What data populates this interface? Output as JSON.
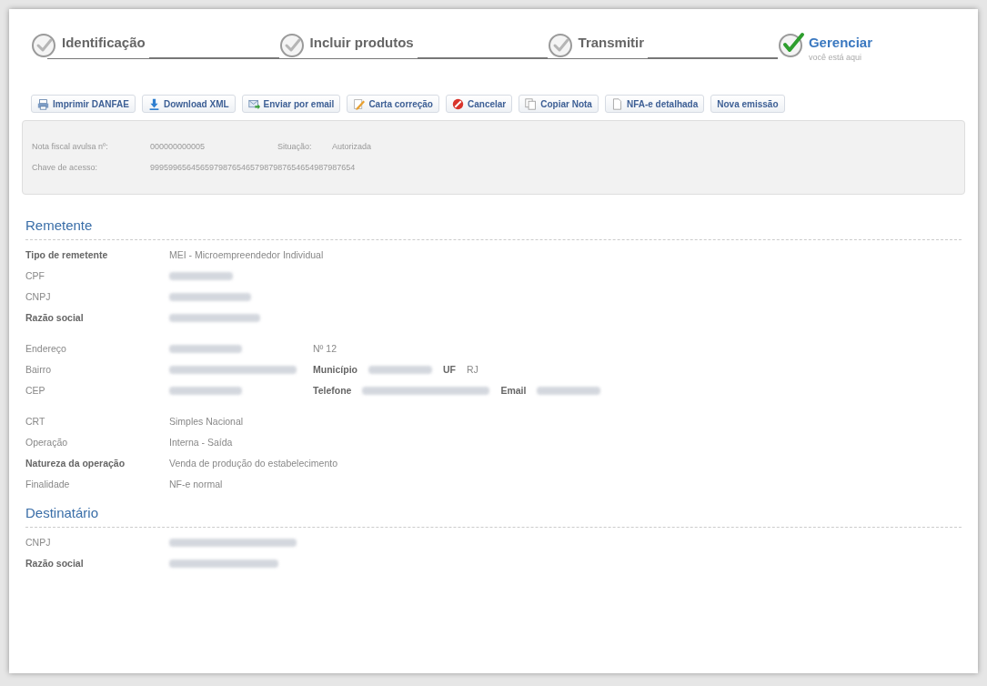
{
  "steps": [
    {
      "label": "Identificação",
      "selected": false
    },
    {
      "label": "Incluir produtos",
      "selected": false
    },
    {
      "label": "Transmitir",
      "selected": false
    },
    {
      "label": "Gerenciar",
      "selected": true,
      "subtitle": "você está aqui"
    }
  ],
  "toolbar": [
    {
      "kind": "print",
      "label": "Imprimir DANFAE"
    },
    {
      "kind": "download",
      "label": "Download XML"
    },
    {
      "kind": "email",
      "label": "Enviar por email"
    },
    {
      "kind": "edit",
      "label": "Carta correção"
    },
    {
      "kind": "cancel",
      "label": "Cancelar"
    },
    {
      "kind": "copy",
      "label": "Copiar Nota"
    },
    {
      "kind": "document",
      "label": "NFA-e detalhada"
    },
    {
      "kind": "plain",
      "label": "Nova emissão"
    }
  ],
  "summary": [
    {
      "label": "Nota fiscal avulsa nº:",
      "value": "000000000005",
      "extra_label": "Situação:",
      "extra_value": "Autorizada"
    },
    {
      "label": "Chave de acesso:",
      "value": "999599656456597987654657987987654654987987654"
    }
  ],
  "sections": [
    {
      "title": "Remetente",
      "groups": [
        [
          {
            "label": "Tipo de remetente",
            "bold": true,
            "cells": [
              {
                "kind": "value",
                "text": "MEI - Microempreendedor Individual"
              }
            ]
          },
          {
            "label": "CPF",
            "bold": false,
            "cells": [
              {
                "kind": "blurred"
              }
            ]
          },
          {
            "label": "CNPJ",
            "bold": false,
            "cells": [
              {
                "kind": "blurred"
              }
            ]
          },
          {
            "label": "Razão social",
            "bold": true,
            "cells": [
              {
                "kind": "blurred"
              }
            ]
          }
        ],
        [
          {
            "label": "Endereço",
            "bold": false,
            "cells": [
              {
                "kind": "blurred"
              },
              {
                "kind": "value",
                "text": "Nº 12"
              }
            ]
          },
          {
            "label": "Bairro",
            "bold": false,
            "cells": [
              {
                "kind": "blurred"
              },
              {
                "kind": "label",
                "text": "Município"
              },
              {
                "kind": "blurred"
              },
              {
                "kind": "label",
                "text": "UF"
              },
              {
                "kind": "value",
                "text": "RJ"
              }
            ]
          },
          {
            "label": "CEP",
            "bold": false,
            "cells": [
              {
                "kind": "blurred"
              },
              {
                "kind": "label",
                "text": "Telefone"
              },
              {
                "kind": "blurred"
              },
              {
                "kind": "label",
                "text": "Email"
              },
              {
                "kind": "blurred"
              }
            ]
          }
        ],
        [
          {
            "label": "CRT",
            "bold": false,
            "cells": [
              {
                "kind": "value",
                "text": "Simples Nacional"
              }
            ]
          },
          {
            "label": "Operação",
            "bold": false,
            "cells": [
              {
                "kind": "value",
                "text": "Interna - Saída"
              }
            ]
          },
          {
            "label": "Natureza da operação",
            "bold": true,
            "cells": [
              {
                "kind": "value",
                "text": "Venda de produção do estabelecimento"
              }
            ]
          },
          {
            "label": "Finalidade",
            "bold": false,
            "cells": [
              {
                "kind": "value",
                "text": "NF-e normal"
              }
            ]
          }
        ]
      ]
    },
    {
      "title": "Destinatário",
      "groups": [
        [
          {
            "label": "CNPJ",
            "bold": false,
            "cells": [
              {
                "kind": "blurred"
              }
            ]
          },
          {
            "label": "Razão social",
            "bold": true,
            "cells": [
              {
                "kind": "blurred"
              }
            ]
          }
        ]
      ]
    }
  ]
}
